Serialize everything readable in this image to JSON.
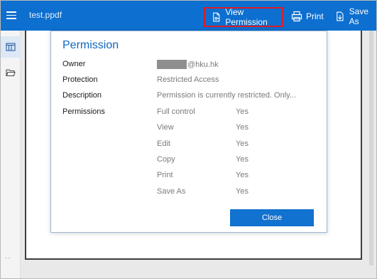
{
  "toolbar": {
    "doc_title": "test.ppdf",
    "view_permission_label": "View Permission",
    "print_label": "Print",
    "save_as_label": "Save As"
  },
  "sidebar": {
    "items": [
      {
        "icon": "thumbnails-icon",
        "active": true
      },
      {
        "icon": "folder-open-icon",
        "active": false
      }
    ],
    "more_label": "··"
  },
  "dialog": {
    "title": "Permission",
    "owner": {
      "label": "Owner",
      "value_suffix": "@hku.hk"
    },
    "protection": {
      "label": "Protection",
      "value": "Restricted Access"
    },
    "description": {
      "label": "Description",
      "value": "Permission is currently restricted. Only..."
    },
    "permissions": {
      "label": "Permissions",
      "items": [
        {
          "name": "Full control",
          "value": "Yes"
        },
        {
          "name": "View",
          "value": "Yes"
        },
        {
          "name": "Edit",
          "value": "Yes"
        },
        {
          "name": "Copy",
          "value": "Yes"
        },
        {
          "name": "Print",
          "value": "Yes"
        },
        {
          "name": "Save As",
          "value": "Yes"
        }
      ]
    },
    "close_label": "Close"
  },
  "colors": {
    "toolbar_bg": "#0d6fcf",
    "accent": "#1172d0",
    "highlight_border": "#d81d2a"
  }
}
